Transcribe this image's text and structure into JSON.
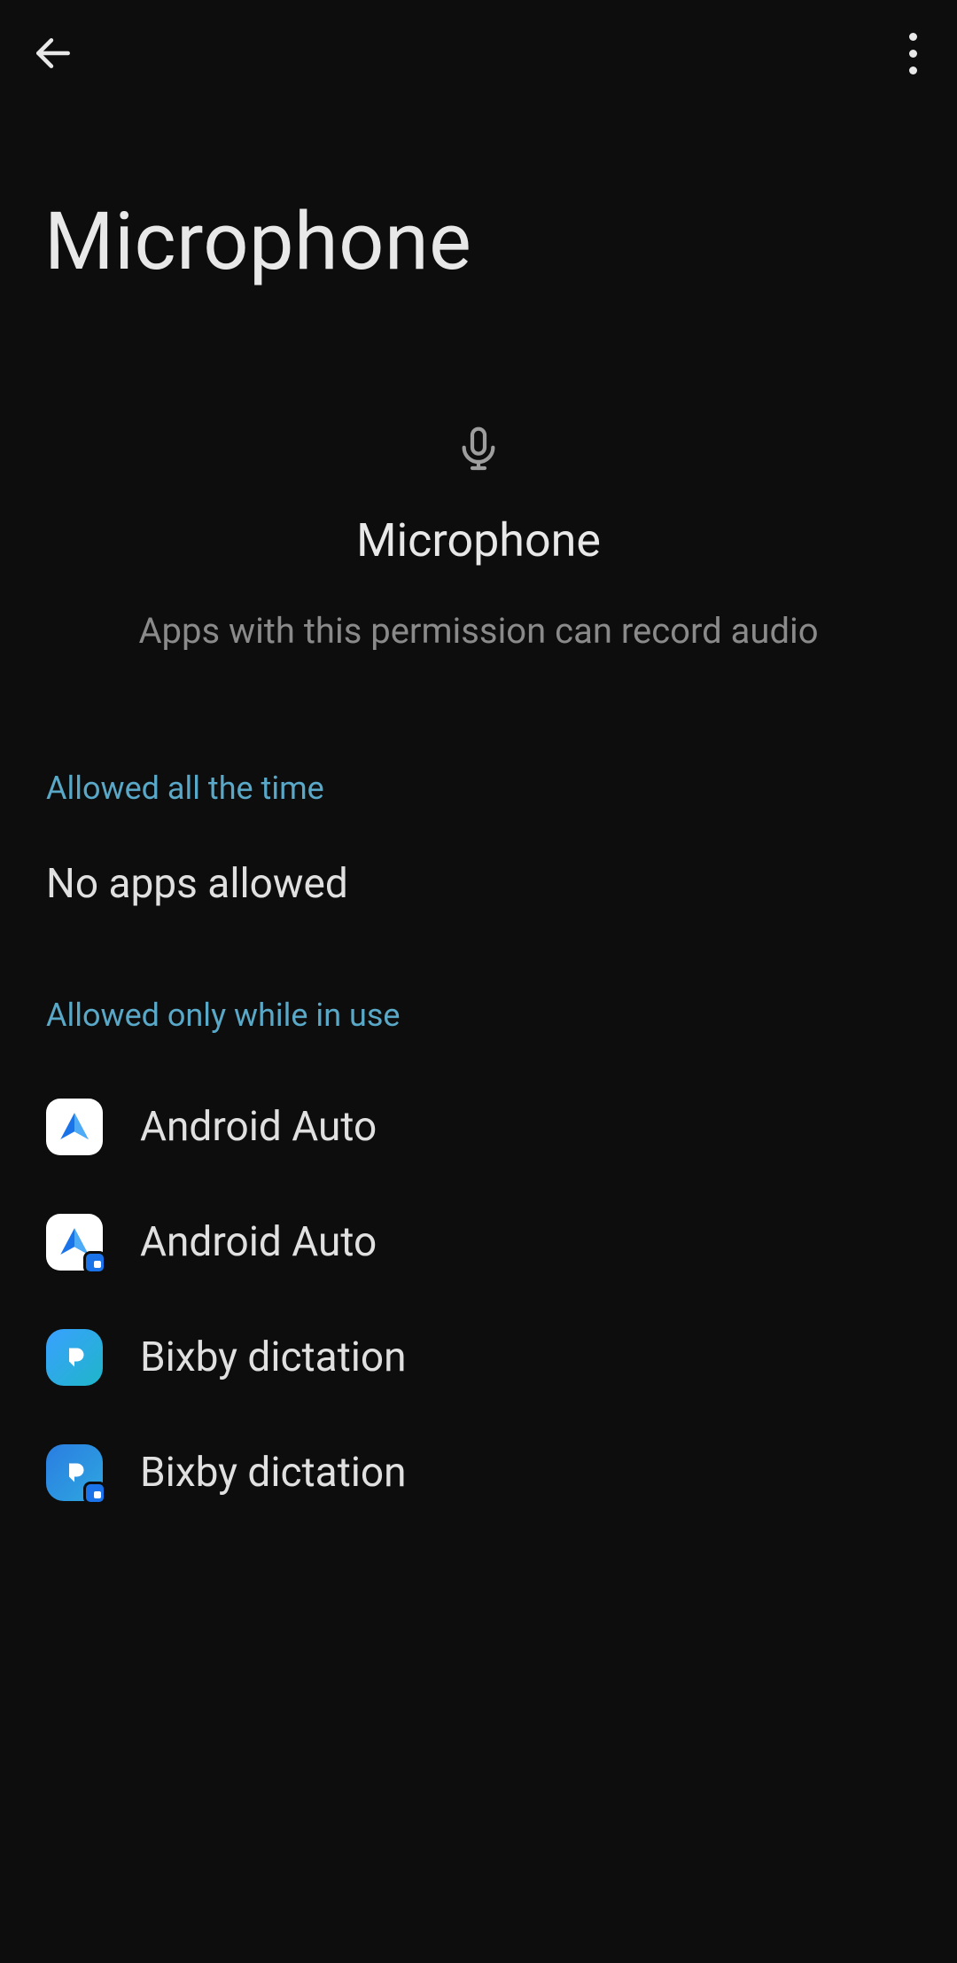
{
  "header": {
    "page_title": "Microphone"
  },
  "permission": {
    "name": "Microphone",
    "description": "Apps with this permission can record audio"
  },
  "sections": {
    "allowed_all_time": {
      "header": "Allowed all the time",
      "empty_text": "No apps allowed"
    },
    "allowed_in_use": {
      "header": "Allowed only while in use",
      "apps": [
        {
          "name": "Android Auto",
          "icon": "android-auto",
          "work_profile": false
        },
        {
          "name": "Android Auto",
          "icon": "android-auto",
          "work_profile": true
        },
        {
          "name": "Bixby dictation",
          "icon": "bixby",
          "work_profile": false
        },
        {
          "name": "Bixby dictation",
          "icon": "bixby",
          "work_profile": true
        }
      ]
    }
  }
}
